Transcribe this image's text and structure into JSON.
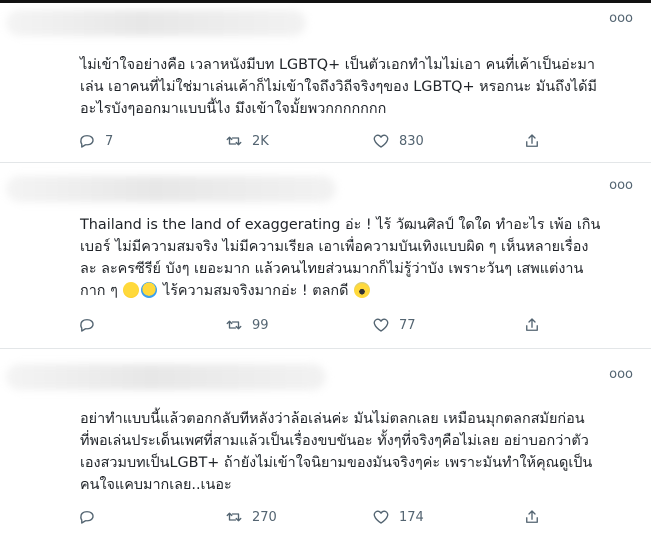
{
  "tweets": [
    {
      "text": "ไม่เข้าใจอย่างคือ เวลาหนังมีบท LGBTQ+ เป็นตัวเอกทำไมไม่เอา คนที่เค้าเป็นอ่ะมา\nเล่น เอาคนที่ไม่ใช่มาเล่นเค้าก็ไม่เข้าใจถึงวิถีจริงๆของ LGBTQ+ หรอกนะ มันถึงได้มี\nอะไรบังๆออกมาแบบนี้ไง มึงเข้าใจมั้ยพวกกกกกกก",
      "reply_count": "7",
      "retweet_count": "2K",
      "like_count": "830"
    },
    {
      "text_before": "Thailand is the land of exaggerating อ่ะ ! ไร้ วัฒนศิลป์ ใดใด ทำอะไร เพ้อ เกิน\nเบอร์ ไม่มีความสมจริง ไม่มีความเรียล เอาเพื่อความบันเทิงแบบผิด ๆ เห็นหลายเรื่อง\nละ ละครซีรีย์ บังๆ เยอะมาก แล้วคนไทยส่วนมากก็ไม่รู้ว่าบัง เพราะวันๆ เสพแต่งาน\nกาก ๆ ",
      "text_after": " ไร้ความสมจริงมากอ่ะ ! ตลกดี ",
      "reply_count": "",
      "retweet_count": "99",
      "like_count": "77"
    },
    {
      "text": "อย่าทำแบบนี้แล้วตอกกลับทีหลังว่าล้อเล่นค่ะ มันไม่ตลกเลย เหมือนมุกตลกสมัยก่อน\nที่พอเล่นประเด็นเพศที่สามแล้วเป็นเรื่องขบขันอะ ทั้งๆที่จริงๆคือไม่เลย อย่าบอกว่าตัว\nเองสวมบทเป็นLGBT+ ถ้ายังไม่เข้าใจนิยามของมันจริงๆค่ะ เพราะมันทำให้คุณดูเป็น\nคนใจแคบมากเลย..เนอะ",
      "reply_count": "",
      "retweet_count": "270",
      "like_count": "174"
    }
  ],
  "icons": {
    "more": "more-dots-icon",
    "reply": "reply-icon",
    "retweet": "retweet-icon",
    "like": "heart-icon",
    "share": "share-icon"
  },
  "more_glyph": "ooo",
  "colors": {
    "text": "#1f2328",
    "muted": "#536471",
    "separator": "#e3e6e8"
  }
}
